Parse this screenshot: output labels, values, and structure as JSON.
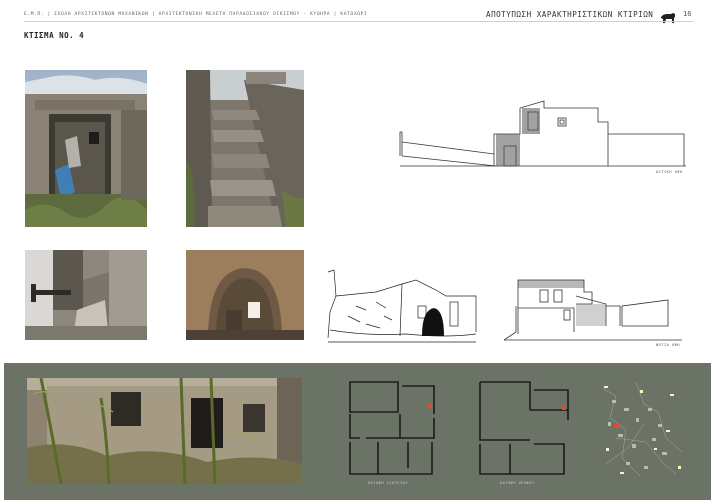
{
  "header": {
    "left_text": "Ε.Μ.Π. | ΣΧΟΛΗ ΑΡΧΙΤΕΚΤΟΝΩΝ ΜΗΧΑΝΙΚΩΝ | ΑΡΧΙΤΕΚΤΟΝΙΚΗ ΜΕΛΕΤΗ ΠΑΡΑΔΟΣΙΑΚΟΥ ΟΙΚΙΣΜΟΥ - ΚΥΘΗΡΑ | ΚΑΤΩΧΩΡΙ",
    "title": "ΑΠΟΤΥΠΩΣΗ ΧΑΡΑΚΤΗΡΙΣΤΙΚΩΝ ΚΤΙΡΙΩΝ",
    "page_number": "16",
    "icon": "animal-silhouette-icon"
  },
  "building_title": "ΚΤΙΣΜΑ ΝΟ. 4",
  "drawings": {
    "west_elevation_caption": "ΔΥΤΙΚΗ ΟΨΗ",
    "south_elevation_caption": "ΝΟΤΙΑ ΟΨΗ",
    "plan1_caption": "ΚΑΤΟΨΗ ΙΣΟΓΕΙΟΥ",
    "plan2_caption": "ΚΑΤΟΨΗ ΟΡΟΦΟΥ"
  },
  "colors": {
    "band": "#6b7266",
    "line": "#333333",
    "site_highlight": "#e04a2e"
  }
}
